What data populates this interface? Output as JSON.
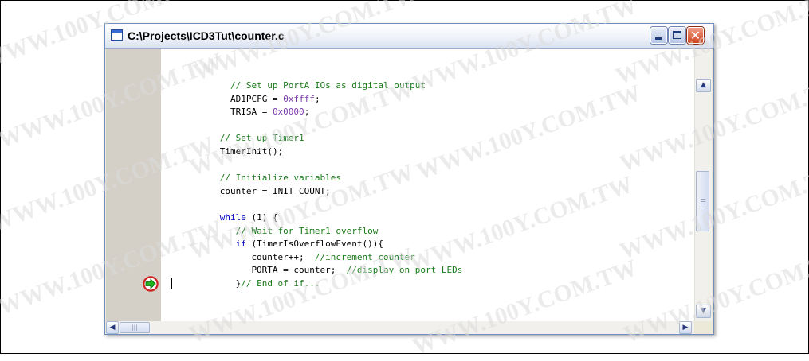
{
  "window": {
    "title": "C:\\Projects\\ICD3Tut\\counter.c",
    "buttons": {
      "minimize": "minimize",
      "maximize": "maximize",
      "close": "✕"
    }
  },
  "code_lines": [
    {
      "indent": 8,
      "tokens": [
        {
          "t": "// Set up PortA IOs as digital output",
          "c": "cm"
        }
      ]
    },
    {
      "indent": 8,
      "tokens": [
        {
          "t": "AD1PCFG = ",
          "c": ""
        },
        {
          "t": "0xffff",
          "c": "nm"
        },
        {
          "t": ";",
          "c": ""
        }
      ]
    },
    {
      "indent": 8,
      "tokens": [
        {
          "t": "TRISA = ",
          "c": ""
        },
        {
          "t": "0x0000",
          "c": "nm"
        },
        {
          "t": ";",
          "c": ""
        }
      ]
    },
    {
      "indent": 0,
      "tokens": []
    },
    {
      "indent": 6,
      "tokens": [
        {
          "t": "// Set up Timer1",
          "c": "cm"
        }
      ]
    },
    {
      "indent": 6,
      "tokens": [
        {
          "t": "TimerInit();",
          "c": ""
        }
      ]
    },
    {
      "indent": 0,
      "tokens": []
    },
    {
      "indent": 6,
      "tokens": [
        {
          "t": "// Initialize variables",
          "c": "cm"
        }
      ]
    },
    {
      "indent": 6,
      "tokens": [
        {
          "t": "counter = INIT_COUNT;",
          "c": ""
        }
      ]
    },
    {
      "indent": 0,
      "tokens": []
    },
    {
      "indent": 6,
      "tokens": [
        {
          "t": "while",
          "c": "kw"
        },
        {
          "t": " (1) {",
          "c": ""
        }
      ]
    },
    {
      "indent": 9,
      "tokens": [
        {
          "t": "// Wait for Timer1 overflow",
          "c": "cm"
        }
      ]
    },
    {
      "indent": 9,
      "tokens": [
        {
          "t": "if",
          "c": "kw"
        },
        {
          "t": " (TimerIsOverflowEvent()){",
          "c": ""
        }
      ]
    },
    {
      "indent": 12,
      "tokens": [
        {
          "t": "counter++;  ",
          "c": ""
        },
        {
          "t": "//increment counter",
          "c": "cm"
        }
      ]
    },
    {
      "indent": 12,
      "tokens": [
        {
          "t": "PORTA = counter;  ",
          "c": ""
        },
        {
          "t": "//display on port LEDs",
          "c": "cm"
        }
      ]
    },
    {
      "indent": 9,
      "tokens": [
        {
          "t": "}",
          "c": ""
        },
        {
          "t": "// End of if...",
          "c": "cm"
        }
      ]
    }
  ],
  "execution_line": 14,
  "scrollbars": {
    "up_arrow": "▲",
    "down_arrow": "▼",
    "left_arrow": "◀",
    "right_arrow": "▶",
    "h_thumb_glyph": "|||"
  },
  "watermark_text": "WWW.100Y.COM.TW",
  "colors": {
    "comment": "#1a7a1a",
    "keyword": "#0000c0",
    "number": "#7a3aa8",
    "gutter": "#d4d0c8",
    "exec_arrow": "#1fb41f",
    "exec_ring": "#d02020"
  }
}
